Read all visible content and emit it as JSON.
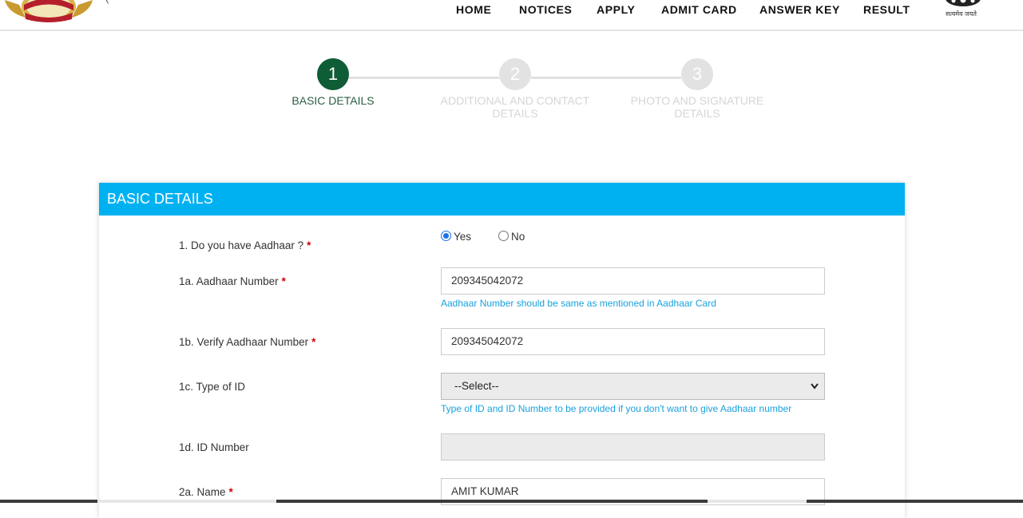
{
  "header": {
    "cutoff_text": "(",
    "nav": [
      {
        "label": "HOME"
      },
      {
        "label": "NOTICES"
      },
      {
        "label": "APPLY"
      },
      {
        "label": "ADMIT CARD"
      },
      {
        "label": "ANSWER KEY"
      },
      {
        "label": "RESULT"
      }
    ],
    "emblem_caption": "सत्यमेव जयते"
  },
  "stepper": {
    "steps": [
      {
        "number": "1",
        "label": "BASIC DETAILS",
        "state": "active"
      },
      {
        "number": "2",
        "label": "ADDITIONAL AND CONTACT DETAILS",
        "state": "inactive"
      },
      {
        "number": "3",
        "label": "PHOTO AND SIGNATURE DETAILS",
        "state": "inactive"
      }
    ]
  },
  "form": {
    "title": "BASIC DETAILS",
    "aadhaar_question": {
      "label": "1. Do you have Aadhaar ?",
      "required": "*",
      "options": [
        "Yes",
        "No"
      ],
      "selected": "Yes"
    },
    "aadhaar_number": {
      "label": "1a. Aadhaar Number",
      "required": "*",
      "value": "209345042072",
      "hint": "Aadhaar Number should be same as mentioned in Aadhaar Card"
    },
    "verify_aadhaar": {
      "label": "1b. Verify Aadhaar Number",
      "required": "*",
      "value": "209345042072"
    },
    "id_type": {
      "label": "1c. Type of ID",
      "selected": "--Select--",
      "hint": "Type of ID and ID Number to be provided if you don't want to give Aadhaar number"
    },
    "id_number": {
      "label": "1d. ID Number",
      "value": ""
    },
    "name": {
      "label": "2a. Name",
      "required": "*",
      "value": "AMIT KUMAR"
    }
  },
  "colors": {
    "header_bar": "#00b1f2",
    "active_step": "#0f5d36",
    "hint": "#18a1dc",
    "required": "#d00000"
  }
}
